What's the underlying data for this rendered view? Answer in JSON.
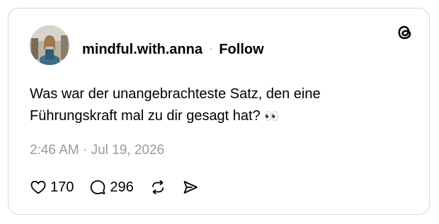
{
  "post": {
    "username": "mindful.with.anna",
    "separator": "·",
    "follow_label": "Follow",
    "text_line1": "Was war der unangebrachteste Satz, den eine",
    "text_line2": "Führungskraft mal zu dir gesagt hat?",
    "emoji": "👀",
    "timestamp": "2:46 AM · Jul 19, 2026"
  },
  "actions": {
    "like_count": "170",
    "reply_count": "296"
  },
  "icons": {
    "brand": "threads-logo-icon",
    "like": "heart-icon",
    "reply": "comment-icon",
    "repost": "repost-icon",
    "share": "send-icon"
  }
}
